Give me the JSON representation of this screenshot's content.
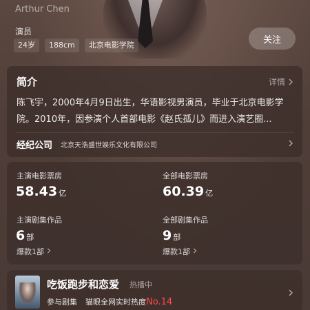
{
  "header": {
    "english_name": "Arthur Chen",
    "occupation": "演员",
    "tags": [
      "24岁",
      "188cm",
      "北京电影学院"
    ],
    "follow_label": "关注"
  },
  "intro": {
    "title": "简介",
    "detail_label": "详情",
    "text": "陈飞宇，2000年4月9日出生，华语影视男演员，毕业于北京电影学院。2010年，因参演个人首部电影《赵氏孤儿》而进入演艺圈...",
    "agency_label": "经纪公司",
    "agency_name": "北京天浩盛世娱乐文化有限公司"
  },
  "stats": {
    "lead_box_office_label": "主演电影票房",
    "lead_box_office_value": "58.43",
    "lead_box_office_unit": "亿",
    "total_box_office_label": "全部电影票房",
    "total_box_office_value": "60.39",
    "total_box_office_unit": "亿",
    "lead_series_label": "主演剧集作品",
    "lead_series_value": "6",
    "lead_series_unit": "部",
    "lead_series_hits": "爆款1部",
    "total_series_label": "全部剧集作品",
    "total_series_value": "9",
    "total_series_unit": "部",
    "total_series_hits": "爆款1部"
  },
  "drama": {
    "title": "吃饭跑步和恋爱",
    "status": "热播中",
    "role": "参与剧集",
    "heat_label": "猫眼全网实时热度",
    "rank": "No.14"
  },
  "colors": {
    "accent_rank": "#ff4a4a",
    "card_bg": "#3c2e2a",
    "page_bg": "#4a3a35"
  }
}
